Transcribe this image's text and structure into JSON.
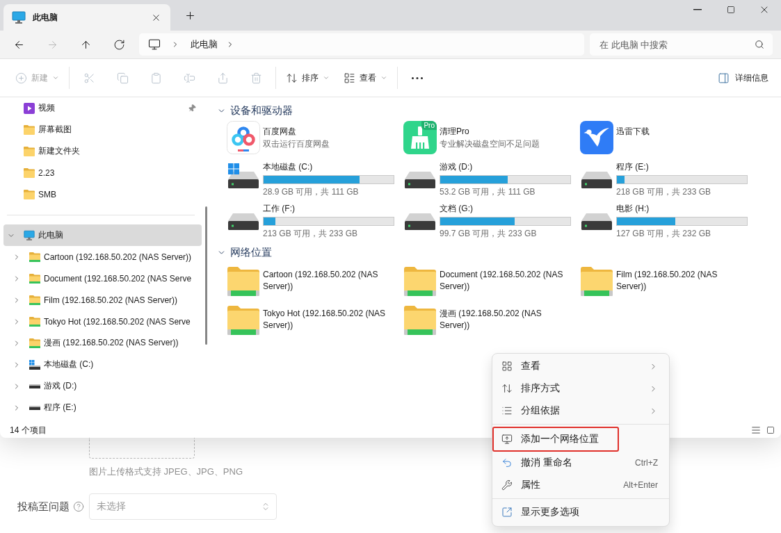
{
  "window": {
    "tabs": [
      {
        "label": "此电脑",
        "selected": true
      }
    ]
  },
  "navigation": {
    "buttons": [
      {
        "kind": "back",
        "disabled": false
      },
      {
        "kind": "forward",
        "disabled": true
      },
      {
        "kind": "up",
        "disabled": false
      },
      {
        "kind": "refresh",
        "disabled": false
      }
    ],
    "address": {
      "segments": [
        "此电脑"
      ]
    },
    "search": {
      "placeholder": "在 此电脑 中搜索"
    }
  },
  "command_bar": {
    "items": [
      {
        "kind": "new",
        "label": "新建",
        "disabled": true,
        "dropdown": true
      },
      {
        "kind": "separator"
      },
      {
        "kind": "cut",
        "disabled": true,
        "dropdown": false
      },
      {
        "kind": "copy",
        "disabled": true,
        "dropdown": false
      },
      {
        "kind": "paste",
        "disabled": true,
        "dropdown": false
      },
      {
        "kind": "rename",
        "disabled": true,
        "dropdown": false
      },
      {
        "kind": "share",
        "disabled": true,
        "dropdown": false
      },
      {
        "kind": "delete",
        "disabled": true,
        "dropdown": false
      },
      {
        "kind": "separator"
      },
      {
        "kind": "sort",
        "label": "排序",
        "disabled": false,
        "dropdown": true
      },
      {
        "kind": "view",
        "label": "查看",
        "disabled": false,
        "dropdown": true
      },
      {
        "kind": "separator"
      },
      {
        "kind": "more",
        "disabled": false,
        "dropdown": false
      }
    ],
    "details": {
      "label": "详细信息"
    }
  },
  "nav_pane": {
    "quick_access": [
      {
        "kind": "videos",
        "label": "视频",
        "pinned": true
      },
      {
        "kind": "folder",
        "label": "屏幕截图",
        "pinned": false
      },
      {
        "kind": "folder",
        "label": "新建文件夹",
        "pinned": false
      },
      {
        "kind": "folder",
        "label": "2.23",
        "pinned": false
      },
      {
        "kind": "folder",
        "label": "SMB",
        "pinned": false
      }
    ],
    "tree": [
      {
        "kind": "pc",
        "label": "此电脑",
        "selected": true,
        "expanded": true,
        "children": [
          {
            "kind": "network",
            "label": "Cartoon (192.168.50.202 (NAS Server))",
            "selected": false,
            "expanded": false
          },
          {
            "kind": "network",
            "label": "Document (192.168.50.202 (NAS Serve",
            "selected": false,
            "expanded": false
          },
          {
            "kind": "network",
            "label": "Film (192.168.50.202 (NAS Server))",
            "selected": false,
            "expanded": false
          },
          {
            "kind": "network",
            "label": "Tokyo Hot (192.168.50.202 (NAS Serve",
            "selected": false,
            "expanded": false
          },
          {
            "kind": "network",
            "label": "漫画 (192.168.50.202 (NAS Server))",
            "selected": false,
            "expanded": false
          },
          {
            "kind": "drive",
            "label": "本地磁盘 (C:)",
            "system": true,
            "selected": false,
            "expanded": false
          },
          {
            "kind": "drive",
            "label": "游戏 (D:)",
            "system": false,
            "selected": false,
            "expanded": false
          },
          {
            "kind": "drive",
            "label": "程序 (E:)",
            "system": false,
            "selected": false,
            "expanded": false
          }
        ]
      }
    ]
  },
  "content": {
    "sections": [
      {
        "title": "设备和驱动器",
        "expanded": true,
        "items": [
          {
            "kind": "app",
            "name": "百度网盘",
            "subtitle": "双击运行百度网盘"
          },
          {
            "kind": "app",
            "name": "清理Pro",
            "subtitle": "专业解决磁盘空间不足问题",
            "badge": "Pro"
          },
          {
            "kind": "app",
            "name": "迅雷下载"
          },
          {
            "kind": "drive",
            "name": "本地磁盘 (C:)",
            "system": true,
            "level": 0.74,
            "reading": "28.9 GB 可用，共 111 GB"
          },
          {
            "kind": "drive",
            "name": "游戏 (D:)",
            "system": false,
            "level": 0.52,
            "reading": "53.2 GB 可用，共 111 GB"
          },
          {
            "kind": "drive",
            "name": "程序 (E:)",
            "system": false,
            "level": 0.06,
            "reading": "218 GB 可用，共 233 GB"
          },
          {
            "kind": "drive",
            "name": "工作 (F:)",
            "system": false,
            "level": 0.09,
            "reading": "213 GB 可用，共 233 GB"
          },
          {
            "kind": "drive",
            "name": "文档 (G:)",
            "system": false,
            "level": 0.57,
            "reading": "99.7 GB 可用，共 233 GB"
          },
          {
            "kind": "drive",
            "name": "电影 (H:)",
            "system": false,
            "level": 0.45,
            "reading": "127 GB 可用，共 232 GB"
          }
        ]
      },
      {
        "title": "网络位置",
        "expanded": true,
        "items": [
          {
            "kind": "network_folder",
            "name": "Cartoon (192.168.50.202 (NAS Server))"
          },
          {
            "kind": "network_folder",
            "name": "Document (192.168.50.202 (NAS Server))"
          },
          {
            "kind": "network_folder",
            "name": "Film (192.168.50.202 (NAS Server))"
          },
          {
            "kind": "network_folder",
            "name": "Tokyo Hot (192.168.50.202 (NAS Server))"
          },
          {
            "kind": "network_folder",
            "name": "漫画 (192.168.50.202 (NAS Server))"
          }
        ]
      }
    ]
  },
  "status_bar": {
    "count": "14 个项目"
  },
  "context_menu": {
    "items": [
      {
        "kind": "item",
        "label": "查看",
        "submenu": true,
        "highlighted": false
      },
      {
        "kind": "item",
        "label": "排序方式",
        "submenu": true,
        "highlighted": false
      },
      {
        "kind": "item",
        "label": "分组依据",
        "submenu": true,
        "highlighted": false
      },
      {
        "kind": "separator"
      },
      {
        "kind": "item",
        "label": "添加一个网络位置",
        "submenu": false,
        "highlighted": true
      },
      {
        "kind": "item",
        "label": "撤消 重命名",
        "shortcut": "Ctrl+Z",
        "submenu": false,
        "highlighted": false
      },
      {
        "kind": "item",
        "label": "属性",
        "shortcut": "Alt+Enter",
        "submenu": false,
        "highlighted": false
      },
      {
        "kind": "separator"
      },
      {
        "kind": "item",
        "label": "显示更多选项",
        "submenu": false,
        "highlighted": false
      }
    ]
  },
  "background_page": {
    "upload_hint": "图片上传格式支持 JPEG、JPG、PNG",
    "question_field": {
      "label": "投稿至问题",
      "placeholder": "未选择"
    }
  }
}
